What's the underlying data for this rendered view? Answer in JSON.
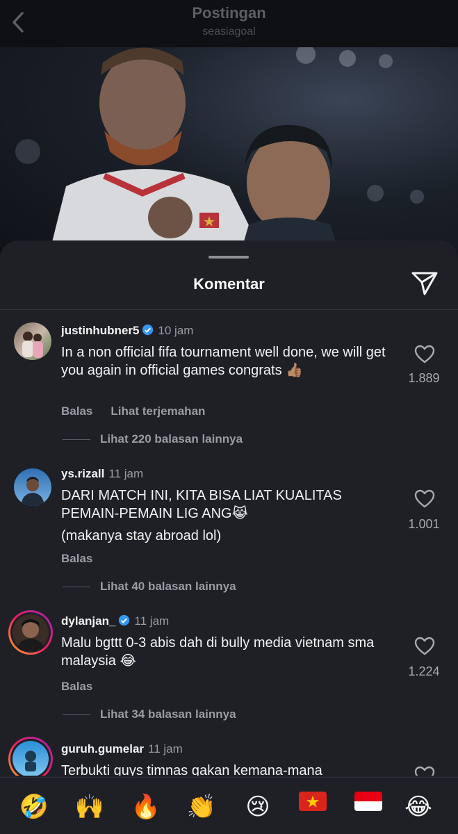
{
  "header": {
    "title": "Postingan",
    "subtitle": "seasiagoal"
  },
  "sheet": {
    "title": "Komentar"
  },
  "comments": [
    {
      "username": "justinhubner5",
      "verified": true,
      "time": "10 jam",
      "text": "In a non official fifa tournament well done, we will get you again in official games  congrats 👍🏽",
      "actions": [
        "Balas",
        "Lihat terjemahan"
      ],
      "likes": "1.889",
      "replies": "Lihat 220 balasan lainnya"
    },
    {
      "username": "ys.rizall",
      "verified": false,
      "time": "11 jam",
      "text": "DARI MATCH INI, KITA BISA LIAT KUALITAS PEMAIN-PEMAIN LIG ANG😹",
      "text2": "(makanya stay abroad lol)",
      "actions": [
        "Balas"
      ],
      "likes": "1.001",
      "replies": "Lihat 40 balasan lainnya"
    },
    {
      "username": "dylanjan_",
      "verified": true,
      "time": "11 jam",
      "text": "Malu bgttt 0-3 abis dah di bully media vietnam sma malaysia 😂",
      "actions": [
        "Balas"
      ],
      "likes": "1.224",
      "replies": "Lihat 34 balasan lainnya"
    },
    {
      "username": "guruh.gumelar",
      "verified": false,
      "time": "11 jam",
      "text": "Terbukti guys timnas gakan kemana-mana"
    }
  ],
  "emoji_bar": [
    "🤣",
    "🙌",
    "🔥",
    "👏",
    "😢",
    "vietnam-flag",
    "indonesia-flag",
    "😂"
  ],
  "colors": {
    "sheet_bg": "#1e2026",
    "verified_blue": "#3797f0",
    "muted_text": "#9a9ca2"
  }
}
